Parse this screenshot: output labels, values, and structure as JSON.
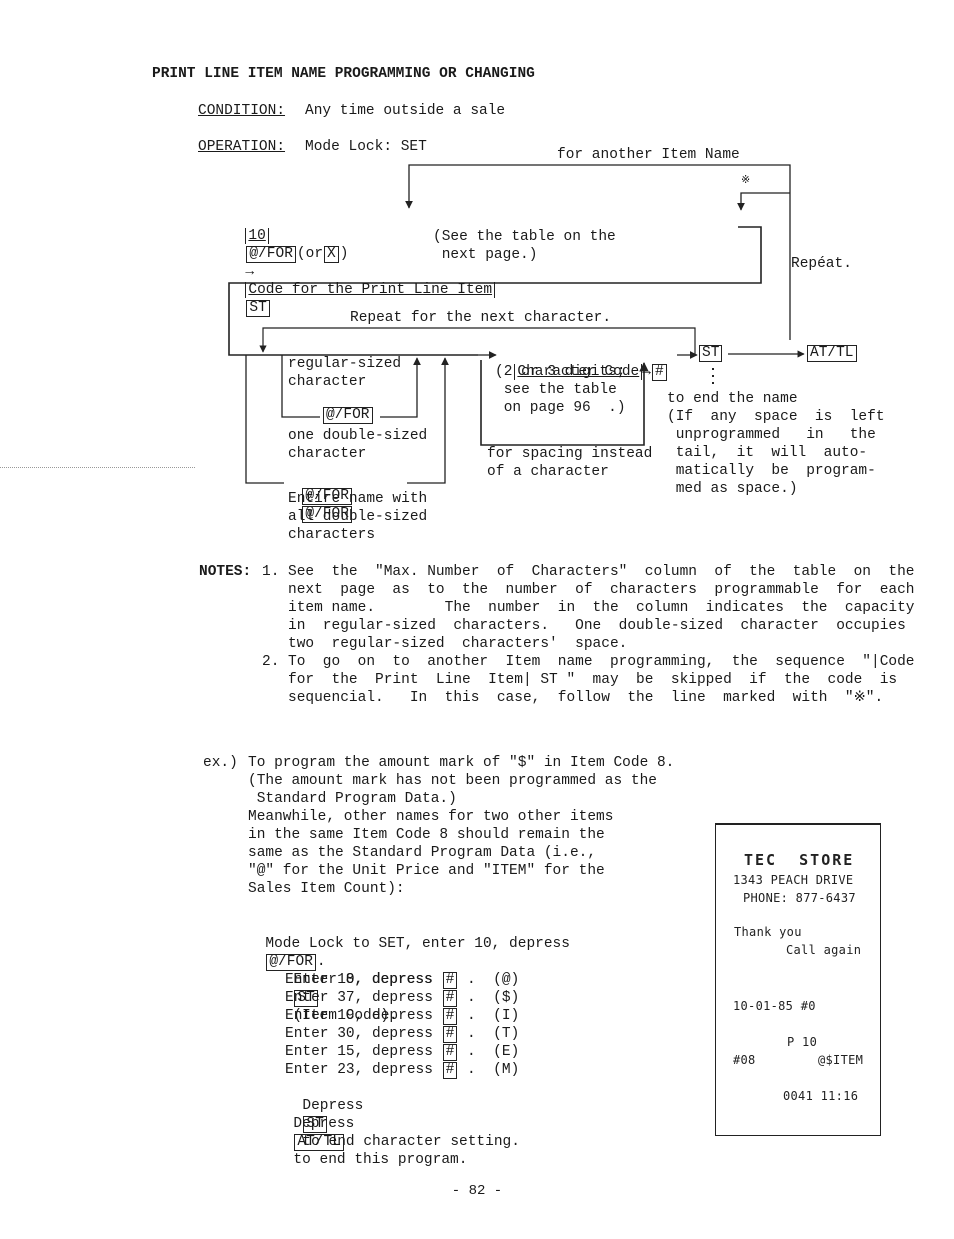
{
  "title": "PRINT LINE ITEM NAME PROGRAMMING OR CHANGING",
  "condition": {
    "label": "CONDITION:",
    "value": "Any time outside a sale"
  },
  "operation": {
    "label": "OPERATION:",
    "value": "Mode Lock: SET"
  },
  "diagram": {
    "loop_another_item": "for another Item Name",
    "asterisk_mark": "※",
    "key_10": "10",
    "key_at_for": "@/FOR",
    "or_open": "(or",
    "key_x": "X",
    "or_close": ")",
    "arrow": "→",
    "code_print_line_item": "Code for the Print Line Item",
    "key_st": "ST",
    "see_table_note": "(See the table on the\n next page.)",
    "repeat_label": "Repéat.",
    "repeat_next_char": "Repeat for the next character.",
    "regular_sized": "regular-sized\ncharacter",
    "one_double_sized": "one double-sized\ncharacter",
    "entire_double": "Entire name with\nall double-sized\ncharacters",
    "character_code": "Character Code",
    "char_code_note": "(2 or 3 digits;\n see the table\n on page 96  .)",
    "key_hash": "#",
    "spacing_note": "for spacing instead\nof a character",
    "key_at_tl": "AT/TL",
    "end_name_note": "to end the name\n(If  any  space  is  left\n unprogrammed   in   the\n tail,  it  will  auto-\n matically  be  program-\n med as space.)"
  },
  "notes": {
    "label": "NOTES:",
    "items": [
      {
        "num": "1.",
        "lines": [
          "See  the  \"Max. Number  of  Characters\"  column  of  the  table  on  the",
          "next  page  as  to  the  number  of  characters  programmable  for  each",
          "item name.        The  number  in  the  column  indicates  the  capacity",
          "in  regular-sized  characters.   One  double-sized  character  occupies",
          "two  regular-sized  characters'  space."
        ]
      },
      {
        "num": "2.",
        "lines": [
          "To  go  on  to  another  Item  name  programming,  the  sequence  \"|Code",
          "for  the  Print  Line  Item| ST \"  may  be  skipped  if  the  code  is",
          "sequencial.   In  this  case,  follow  the  line  marked  with  \"※\"."
        ]
      }
    ]
  },
  "example": {
    "label": "ex.)",
    "intro_lines": [
      "To program the amount mark of \"$\" in Item Code 8.",
      "(The amount mark has not been programmed as the",
      " Standard Program Data.)",
      "Meanwhile, other names for two other items",
      "in the same Item Code 8 should remain the",
      "same as the Standard Program Data (i.e.,",
      "\"@\" for the Unit Price and \"ITEM\" for the",
      "Sales Item Count):"
    ],
    "mode_lock_prefix": "Mode Lock to SET, enter 10, depress",
    "mode_lock_key": "@/FOR",
    "mode_lock_suffix": ".",
    "item_code_step": {
      "prefix": "Enter 8, depress",
      "key": "ST",
      "suffix": "(Item Code)."
    },
    "char_steps": [
      {
        "code": "10",
        "char": "(@)"
      },
      {
        "code": "37",
        "char": "($)"
      },
      {
        "code": "19",
        "char": "(I)"
      },
      {
        "code": "30",
        "char": "(T)"
      },
      {
        "code": "15",
        "char": "(E)"
      },
      {
        "code": "23",
        "char": "(M)"
      }
    ],
    "enter_word": "Enter",
    "depress_word": "depress",
    "hash_key": "#",
    "end_char": {
      "prefix": "Depress",
      "key": "ST",
      "suffix": "to end character setting."
    },
    "end_program": {
      "prefix": "Depress",
      "key": "AT/TL",
      "suffix": "to end this program."
    }
  },
  "receipt": {
    "store_name": "TEC  STORE",
    "address": "1343 PEACH DRIVE",
    "phone": "PHONE: 877-6437",
    "thanks": "Thank you",
    "call_again": "Call again",
    "date_line": "10-01-85 #0",
    "p_mark": "P 10",
    "item_code": "#08",
    "item_names": "@$ITEM",
    "footer": "0041 11:16"
  },
  "page_number": "- 82 -"
}
